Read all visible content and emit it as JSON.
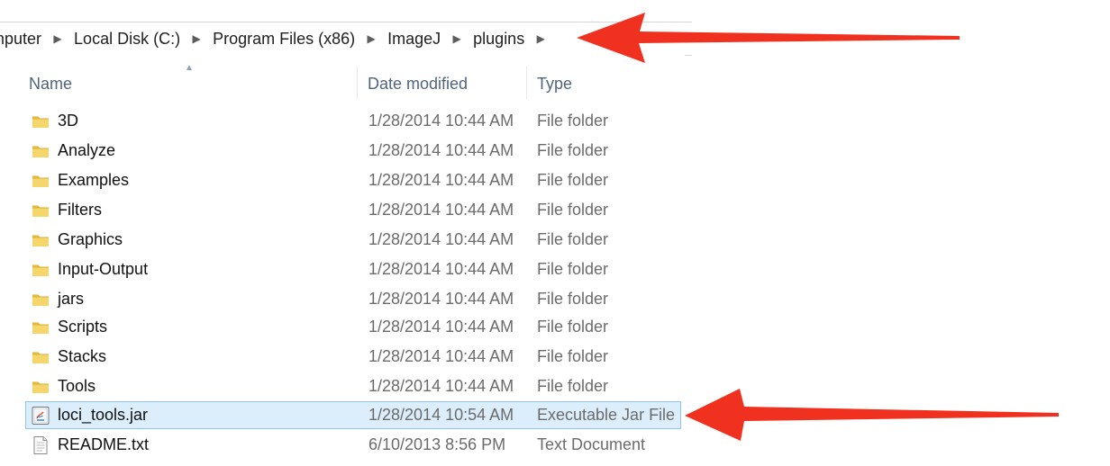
{
  "breadcrumb": {
    "items": [
      {
        "label": "omputer"
      },
      {
        "label": "Local Disk (C:)"
      },
      {
        "label": "Program Files (x86)"
      },
      {
        "label": "ImageJ"
      },
      {
        "label": "plugins"
      }
    ]
  },
  "columns": {
    "name": "Name",
    "date_modified": "Date modified",
    "type": "Type"
  },
  "files": [
    {
      "name": "3D",
      "date": "1/28/2014 10:44 AM",
      "type": "File folder",
      "icon": "folder-icon"
    },
    {
      "name": "Analyze",
      "date": "1/28/2014 10:44 AM",
      "type": "File folder",
      "icon": "folder-icon"
    },
    {
      "name": "Examples",
      "date": "1/28/2014 10:44 AM",
      "type": "File folder",
      "icon": "folder-icon"
    },
    {
      "name": "Filters",
      "date": "1/28/2014 10:44 AM",
      "type": "File folder",
      "icon": "folder-icon"
    },
    {
      "name": "Graphics",
      "date": "1/28/2014 10:44 AM",
      "type": "File folder",
      "icon": "folder-icon"
    },
    {
      "name": "Input-Output",
      "date": "1/28/2014 10:44 AM",
      "type": "File folder",
      "icon": "folder-icon"
    },
    {
      "name": "jars",
      "date": "1/28/2014 10:44 AM",
      "type": "File folder",
      "icon": "folder-icon"
    },
    {
      "name": "Scripts",
      "date": "1/28/2014 10:44 AM",
      "type": "File folder",
      "icon": "folder-icon"
    },
    {
      "name": "Stacks",
      "date": "1/28/2014 10:44 AM",
      "type": "File folder",
      "icon": "folder-icon"
    },
    {
      "name": "Tools",
      "date": "1/28/2014 10:44 AM",
      "type": "File folder",
      "icon": "folder-icon"
    },
    {
      "name": "loci_tools.jar",
      "date": "1/28/2014 10:54 AM",
      "type": "Executable Jar File",
      "icon": "java-jar-icon",
      "selected": true
    },
    {
      "name": "README.txt",
      "date": "6/10/2013 8:56 PM",
      "type": "Text Document",
      "icon": "text-file-icon"
    }
  ],
  "colors": {
    "selection_fill": "#dceefb",
    "selection_border": "#8fc5ed",
    "arrow": "#f0311f",
    "header_text": "#50657d"
  }
}
